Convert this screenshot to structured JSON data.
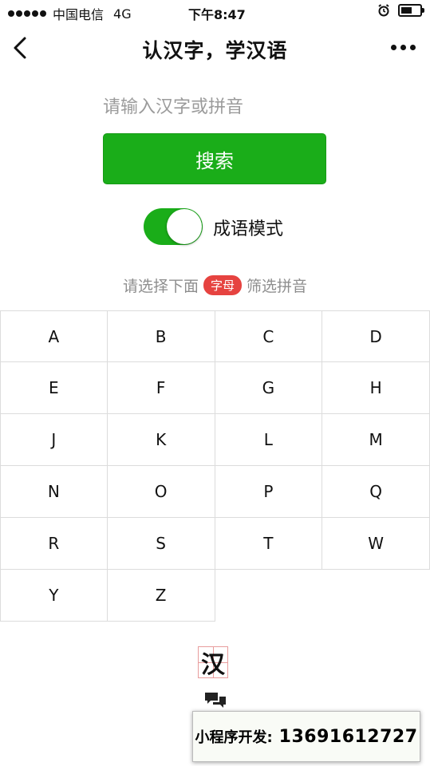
{
  "status_bar": {
    "carrier": "中国电信",
    "network": "4G",
    "time": "下午8:47",
    "battery_level": 0.6
  },
  "nav": {
    "title": "认汉字，学汉语",
    "back_icon": "chevron-left-icon",
    "more_icon": "more-dots-icon"
  },
  "search": {
    "placeholder": "请输入汉字或拼音",
    "button_label": "搜索"
  },
  "idiom_mode": {
    "label": "成语模式",
    "enabled": true
  },
  "hint": {
    "prefix": "请选择下面",
    "badge": "字母",
    "suffix": "筛选拼音"
  },
  "letters": [
    "A",
    "B",
    "C",
    "D",
    "E",
    "F",
    "G",
    "H",
    "J",
    "K",
    "L",
    "M",
    "N",
    "O",
    "P",
    "Q",
    "R",
    "S",
    "T",
    "W",
    "Y",
    "Z"
  ],
  "footer": {
    "logo_char": "汉",
    "chat_icon": "chat-bubbles-icon"
  },
  "contact": {
    "label": "小程序开发:",
    "phone": "13691612727"
  },
  "colors": {
    "primary_green": "#1aad19",
    "badge_red": "#e64340"
  }
}
